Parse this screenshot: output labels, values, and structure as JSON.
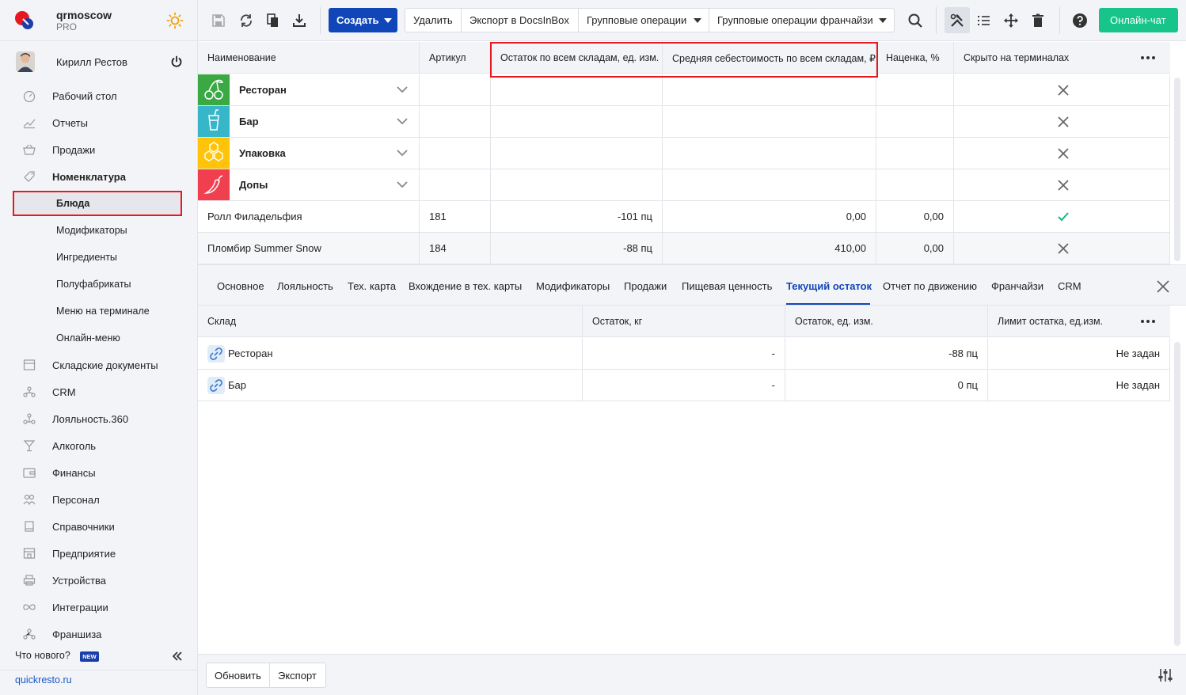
{
  "sidebar": {
    "company": "qrmoscow",
    "plan": "PRO",
    "user": "Кирилл Рестов",
    "nav": [
      {
        "label": "Рабочий стол",
        "icon": "dashboard-icon"
      },
      {
        "label": "Отчеты",
        "icon": "reports-icon"
      },
      {
        "label": "Продажи",
        "icon": "basket-icon"
      },
      {
        "label": "Номенклатура",
        "icon": "tag-icon"
      },
      {
        "label": "Блюда"
      },
      {
        "label": "Модификаторы"
      },
      {
        "label": "Ингредиенты"
      },
      {
        "label": "Полуфабрикаты"
      },
      {
        "label": "Меню на терминале"
      },
      {
        "label": "Онлайн-меню"
      },
      {
        "label": "Складские документы",
        "icon": "warehouse-icon"
      },
      {
        "label": "CRM",
        "icon": "crm-icon"
      },
      {
        "label": "Лояльность.360",
        "icon": "loyalty-icon"
      },
      {
        "label": "Алкоголь",
        "icon": "glass-icon"
      },
      {
        "label": "Финансы",
        "icon": "wallet-icon"
      },
      {
        "label": "Персонал",
        "icon": "people-icon"
      },
      {
        "label": "Справочники",
        "icon": "book-icon"
      },
      {
        "label": "Предприятие",
        "icon": "store-icon"
      },
      {
        "label": "Устройства",
        "icon": "printer-icon"
      },
      {
        "label": "Интеграции",
        "icon": "infinity-icon"
      },
      {
        "label": "Франшиза",
        "icon": "franchise-icon"
      }
    ],
    "whats_new": "Что нового?",
    "new_badge": "NEW",
    "site_link": "quickresto.ru"
  },
  "toolbar": {
    "create": "Создать",
    "delete": "Удалить",
    "export_docs": "Экспорт в DocsInBox",
    "group_ops": "Групповые операции",
    "group_ops_franchise": "Групповые операции франчайзи",
    "online_chat": "Онлайн-чат"
  },
  "table": {
    "headers": [
      "Наименование",
      "Артикул",
      "Остаток по всем складам, ед. изм.",
      "Средняя себестоимость по всем складам, ₽",
      "Наценка, %",
      "Скрыто на терминалах"
    ],
    "categories": [
      {
        "name": "Ресторан",
        "color": "#3aa843",
        "icon": "cherry-icon"
      },
      {
        "name": "Бар",
        "color": "#37b6c9",
        "icon": "cocktail-icon"
      },
      {
        "name": "Упаковка",
        "color": "#ffc40a",
        "icon": "honeycomb-icon"
      },
      {
        "name": "Допы",
        "color": "#f0404f",
        "icon": "pepper-icon"
      }
    ],
    "items": [
      {
        "name": "Ролл Филадельфия",
        "article": "181",
        "stock": "-101 пц",
        "cost": "0,00",
        "markup": "0,00",
        "hidden": false
      },
      {
        "name": "Пломбир Summer Snow",
        "article": "184",
        "stock": "-88 пц",
        "cost": "410,00",
        "markup": "0,00",
        "hidden": true
      }
    ]
  },
  "tabs": [
    "Основное",
    "Лояльность",
    "Тех. карта",
    "Вхождение в тех. карты",
    "Модификаторы",
    "Продажи",
    "Пищевая ценность",
    "Текущий остаток",
    "Отчет по движению",
    "Франчайзи",
    "CRM"
  ],
  "active_tab": "Текущий остаток",
  "subtable": {
    "headers": [
      "Склад",
      "Остаток, кг",
      "Остаток, ед. изм.",
      "Лимит остатка, ед.изм."
    ],
    "rows": [
      {
        "warehouse": "Ресторан",
        "kg": "-",
        "units": "-88 пц",
        "limit": "Не задан"
      },
      {
        "warehouse": "Бар",
        "kg": "-",
        "units": "0 пц",
        "limit": "Не задан"
      }
    ]
  },
  "footer": {
    "refresh": "Обновить",
    "export": "Экспорт"
  },
  "colors": {
    "accent": "#1046b8",
    "highlight": "#e8191e",
    "chat": "#17c58a"
  }
}
